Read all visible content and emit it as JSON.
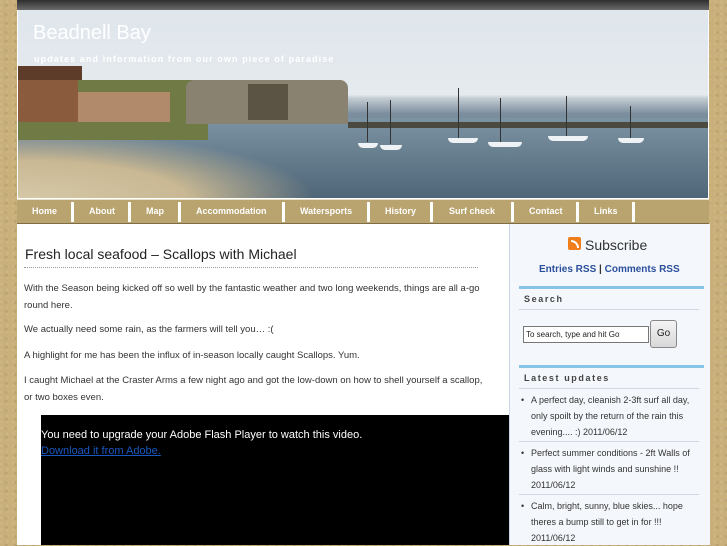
{
  "header": {
    "title": "Beadnell Bay",
    "tagline": "updates and information from our own piece of paradise"
  },
  "nav": {
    "items": [
      "Home",
      "About",
      "Map",
      "Accommodation",
      "Watersports",
      "History",
      "Surf check",
      "Contact",
      "Links"
    ]
  },
  "post": {
    "title": "Fresh local seafood – Scallops with Michael",
    "paragraphs": [
      "With the Season being kicked off so well by the fantastic weather and two long weekends, things are all a-go round here.",
      "We actually need some rain, as the farmers will tell you… :(",
      "A highlight for me has been the influx of in-season locally caught Scallops. Yum.",
      "I caught Michael at the Craster Arms a few night ago and got the low-down on how to shell yourself a scallop, or two boxes even."
    ],
    "video": {
      "message": "You need to upgrade your Adobe Flash Player to watch this video.",
      "link": "Download it from Adobe."
    }
  },
  "sidebar": {
    "subscribe": "Subscribe",
    "entries_rss": "Entries RSS",
    "separator": " | ",
    "comments_rss": "Comments RSS",
    "search_heading": "Search",
    "search_placeholder": "To search, type and hit Go",
    "go_label": "Go",
    "latest_heading": "Latest updates",
    "updates": [
      "A perfect day, cleanish 2-3ft surf all day, only spoilt by the return of the rain this evening.... :) 2011/06/12",
      "Perfect summer conditions - 2ft Walls of glass with light winds and sunshine !! 2011/06/12",
      "Calm, bright, sunny, blue skies... hope theres a bump still to get in for !!! 2011/06/12"
    ]
  },
  "colors": {
    "nav_bg": "#b9a36e",
    "accent_blue": "#88c4e8",
    "link_blue": "#2a4f9c",
    "rss_orange": "#f07e1a"
  }
}
